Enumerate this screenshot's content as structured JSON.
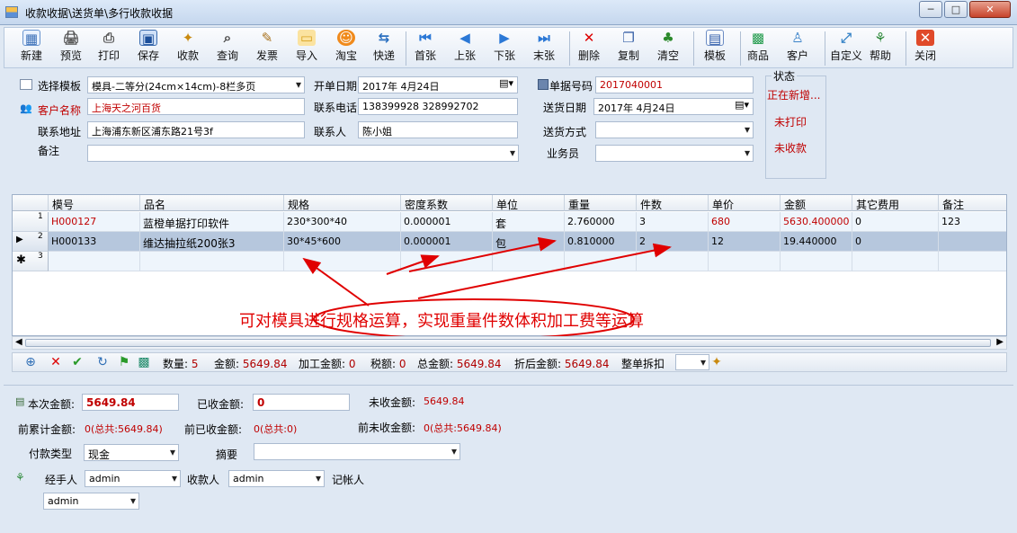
{
  "window": {
    "title": "收款收据\\送货单\\多行收款收据"
  },
  "toolbar": {
    "items": [
      "新建",
      "预览",
      "打印",
      "保存",
      "收款",
      "查询",
      "发票",
      "导入",
      "淘宝",
      "快递",
      "首张",
      "上张",
      "下张",
      "末张",
      "删除",
      "复制",
      "清空",
      "模板",
      "商品",
      "客户",
      "自定义",
      "帮助",
      "关闭"
    ]
  },
  "form": {
    "template_label": "选择模板",
    "template_value": "模具-二等分(24cm×14cm)-8栏多页",
    "date_label": "开单日期",
    "date_value": "2017年 4月24日",
    "docno_label": "单据号码",
    "docno_value": "2017040001",
    "customer_label": "客户名称",
    "customer_value": "上海天之河百货",
    "phone_label": "联系电话",
    "phone_value": "138399928 328992702",
    "shipdate_label": "送货日期",
    "shipdate_value": "2017年 4月24日",
    "address_label": "联系地址",
    "address_value": "上海浦东新区浦东路21号3f",
    "contact_label": "联系人",
    "contact_value": "陈小姐",
    "shipmethod_label": "送货方式",
    "shipmethod_value": "",
    "remark_label": "备注",
    "remark_value": "",
    "salesman_label": "业务员",
    "salesman_value": ""
  },
  "status": {
    "title": "状态",
    "line1": "正在新增...",
    "line2": "未打印",
    "line3": "未收款"
  },
  "grid": {
    "columns": [
      "模号",
      "品名",
      "规格",
      "密度系数",
      "单位",
      "重量",
      "件数",
      "单价",
      "金额",
      "其它费用",
      "备注"
    ],
    "rows": [
      {
        "num": "1",
        "cells": [
          "H000127",
          "蓝橙单据打印软件",
          "230*300*40",
          "0.000001",
          "套",
          "2.760000",
          "3",
          "680",
          "5630.400000",
          "0",
          "123"
        ]
      },
      {
        "num": "2",
        "cells": [
          "H000133",
          "维达抽拉纸200张3",
          "30*45*600",
          "0.000001",
          "包",
          "0.810000",
          "2",
          "12",
          "19.440000",
          "0",
          ""
        ]
      },
      {
        "num": "3",
        "cells": [
          "",
          "",
          "",
          "",
          "",
          "",
          "",
          "",
          "",
          "",
          ""
        ]
      }
    ]
  },
  "annotation": "可对模具进行规格运算，实现重量件数体积加工费等运算",
  "summary": {
    "qty_label": "数量:",
    "qty_value": "5",
    "amount_label": "金额:",
    "amount_value": "5649.84",
    "process_label": "加工金额:",
    "process_value": "0",
    "tax_label": "税额:",
    "tax_value": "0",
    "total_label": "总金额:",
    "total_value": "5649.84",
    "discount_label": "折后金额:",
    "discount_value": "5649.84",
    "round_label": "整单拆扣"
  },
  "payment": {
    "current_label": "本次金额:",
    "current_value": "5649.84",
    "received_label": "已收金额:",
    "received_value": "0",
    "unreceived_label": "未收金额:",
    "unreceived_value": "5649.84",
    "prev_total_label": "前累计金额:",
    "prev_total_value": "0(总共:5649.84)",
    "prev_received_label": "前已收金额:",
    "prev_received_value": "0(总共:0)",
    "prev_unreceived_label": "前未收金额:",
    "prev_unreceived_value": "0(总共:5649.84)",
    "paytype_label": "付款类型",
    "paytype_value": "现金",
    "summary_label": "摘要",
    "summary_value": "",
    "handler_label": "经手人",
    "handler_value": "admin",
    "collector_label": "收款人",
    "collector_value": "admin",
    "bookkeeper_label": "记帐人",
    "bookkeeper_value": "admin"
  }
}
